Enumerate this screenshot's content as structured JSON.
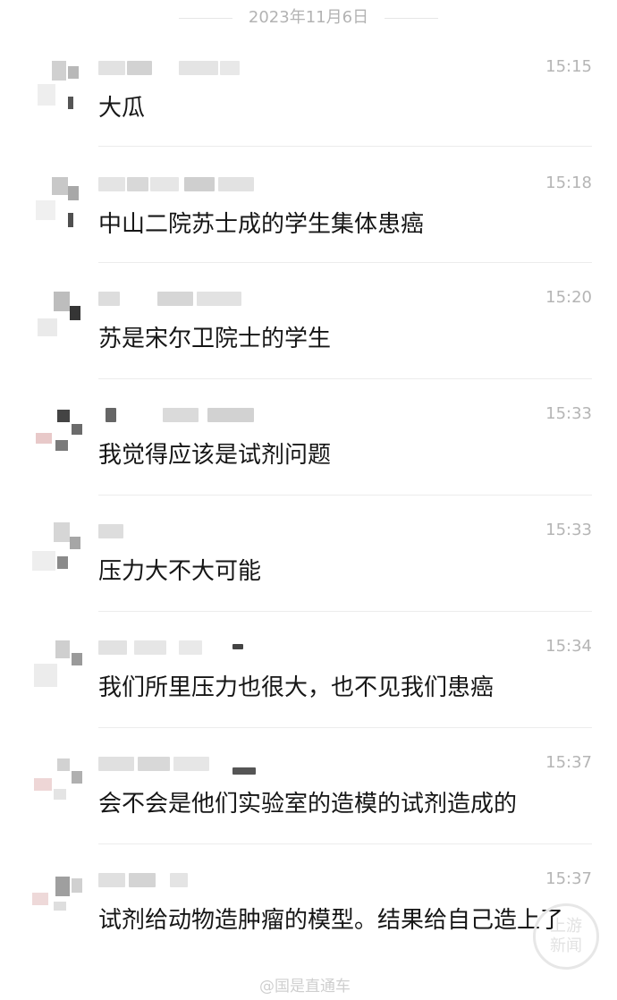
{
  "chat": {
    "date": "2023年11月6日",
    "messages": [
      {
        "time": "15:15",
        "text": "大瓜"
      },
      {
        "time": "15:18",
        "text": "中山二院苏士成的学生集体患癌"
      },
      {
        "time": "15:20",
        "text": "苏是宋尔卫院士的学生"
      },
      {
        "time": "15:33",
        "text": "我觉得应该是试剂问题"
      },
      {
        "time": "15:33",
        "text": "压力大不大可能"
      },
      {
        "time": "15:34",
        "text": "我们所里压力也很大，也不见我们患癌"
      },
      {
        "time": "15:37",
        "text": "会不会是他们实验室的造模的试剂造成的"
      },
      {
        "time": "15:37",
        "text": "试剂给动物造肿瘤的模型。结果给自己造上了"
      }
    ]
  },
  "watermark": {
    "logo_line1": "上游",
    "logo_line2": "新闻",
    "text": "@国是直通车"
  }
}
